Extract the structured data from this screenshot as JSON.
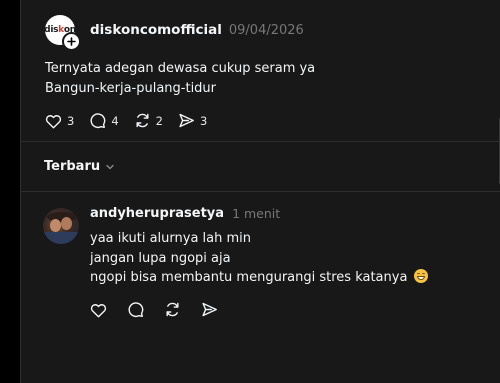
{
  "post": {
    "logo_text_a": "dis",
    "logo_text_b": "k",
    "logo_text_c": "on",
    "username": "diskoncomofficial",
    "timestamp": "09/04/2026",
    "lines": [
      "Ternyata adegan dewasa cukup seram ya",
      "Bangun-kerja-pulang-tidur"
    ],
    "like_count": "3",
    "comment_count": "4",
    "repost_count": "2",
    "share_count": "3"
  },
  "sort": {
    "label": "Terbaru"
  },
  "reply": {
    "username": "andyheruprasetya",
    "time": "1 menit",
    "lines": [
      "yaa ikuti alurnya lah min",
      "jangan lupa ngopi aja",
      "ngopi bisa membantu mengurangi stres katanya"
    ],
    "emoji": "grinning-face-with-smiling-eyes"
  },
  "colors": {
    "background": "#000000",
    "panel": "#181818",
    "text": "#f3f5f7",
    "muted": "#777777",
    "divider": "#2d2d2d"
  }
}
